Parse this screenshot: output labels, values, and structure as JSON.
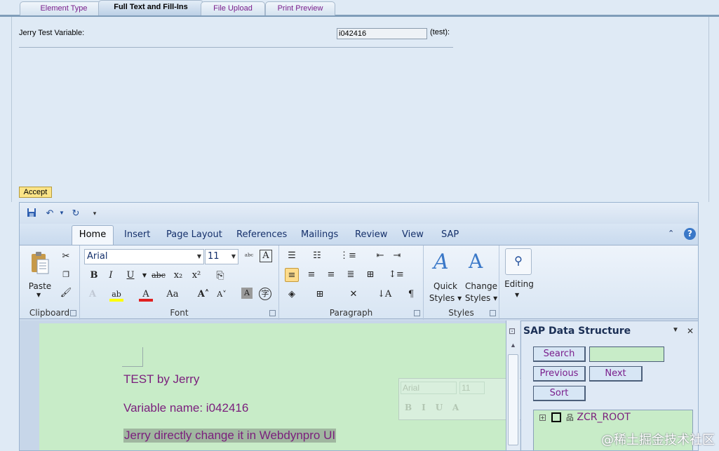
{
  "tabs": [
    {
      "label": "Element Type"
    },
    {
      "label": "Full Text and Fill-Ins"
    },
    {
      "label": "File Upload"
    },
    {
      "label": "Print Preview"
    }
  ],
  "form": {
    "label": "Jerry Test Variable:",
    "value": "i042416",
    "suffix": "(test):",
    "accept_label": "Accept"
  },
  "ribbon_tabs": [
    "Home",
    "Insert",
    "Page Layout",
    "References",
    "Mailings",
    "Review",
    "View",
    "SAP"
  ],
  "ribbon": {
    "clipboard": {
      "paste_label": "Paste",
      "title": "Clipboard"
    },
    "font": {
      "name": "Arial",
      "size": "11",
      "title": "Font"
    },
    "paragraph": {
      "title": "Paragraph"
    },
    "styles": {
      "quick_line1": "Quick",
      "quick_line2": "Styles",
      "change_line1": "Change",
      "change_line2": "Styles",
      "title": "Styles"
    },
    "editing": {
      "label": "Editing"
    }
  },
  "document": {
    "lines": [
      "TEST by Jerry",
      "Variable name: i042416",
      "Jerry directly change it in Webdynpro UI"
    ]
  },
  "mini_toolbar": {
    "font": "Arial",
    "size": "11"
  },
  "sap_pane": {
    "title": "SAP Data Structure",
    "search_label": "Search",
    "search_value": "",
    "previous_label": "Previous",
    "next_label": "Next",
    "sort_label": "Sort",
    "tree_root": "ZCR_ROOT"
  },
  "watermark": "@稀土掘金技术社区"
}
